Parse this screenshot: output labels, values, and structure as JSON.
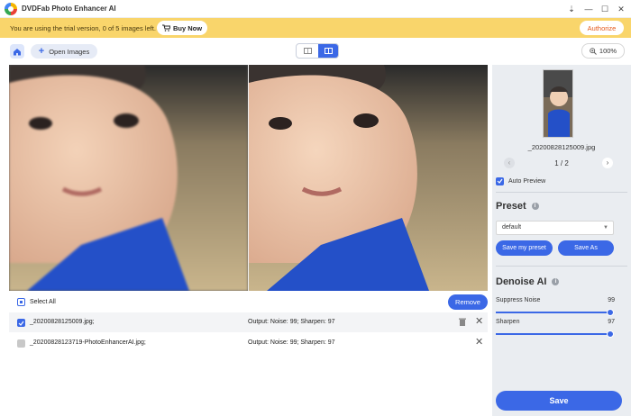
{
  "app": {
    "title": "DVDFab Photo Enhancer AI",
    "window_controls": {
      "pin": "⇣",
      "minimize": "—",
      "maximize": "☐",
      "close": "✕"
    }
  },
  "banner": {
    "trial_text": "You are using the trial version, 0 of 5 images left.",
    "buy_now_label": "Buy Now",
    "authorize_label": "Authorize"
  },
  "toolbar": {
    "open_images_label": "Open Images",
    "zoom_label": "100%"
  },
  "list": {
    "select_all_label": "Select All",
    "remove_label": "Remove",
    "rows": [
      {
        "filename": "_20200828125009.jpg;",
        "output": "Output: Noise: 99; Sharpen: 97",
        "checked": true
      },
      {
        "filename": "_20200828123719-PhotoEnhancerAI.jpg;",
        "output": "Output: Noise: 99; Sharpen: 97",
        "checked": false
      }
    ]
  },
  "sidebar": {
    "thumbnail_name": "_20200828125009.jpg",
    "pager_text": "1 / 2",
    "auto_preview_label": "Auto Preview",
    "auto_preview_checked": true,
    "preset": {
      "title": "Preset",
      "selected": "default",
      "save_my_preset_label": "Save my preset",
      "save_as_label": "Save As"
    },
    "denoise": {
      "title": "Denoise AI",
      "sliders": [
        {
          "label": "Suppress Noise",
          "value": "99",
          "level": 0.99
        },
        {
          "label": "Sharpen",
          "value": "97",
          "level": 0.97
        }
      ]
    },
    "save_label": "Save"
  },
  "colors": {
    "accent": "#3b68e6",
    "banner": "#f9d56b",
    "authorize_text": "#e55a1c",
    "sidebar_bg": "#eaedf1"
  }
}
